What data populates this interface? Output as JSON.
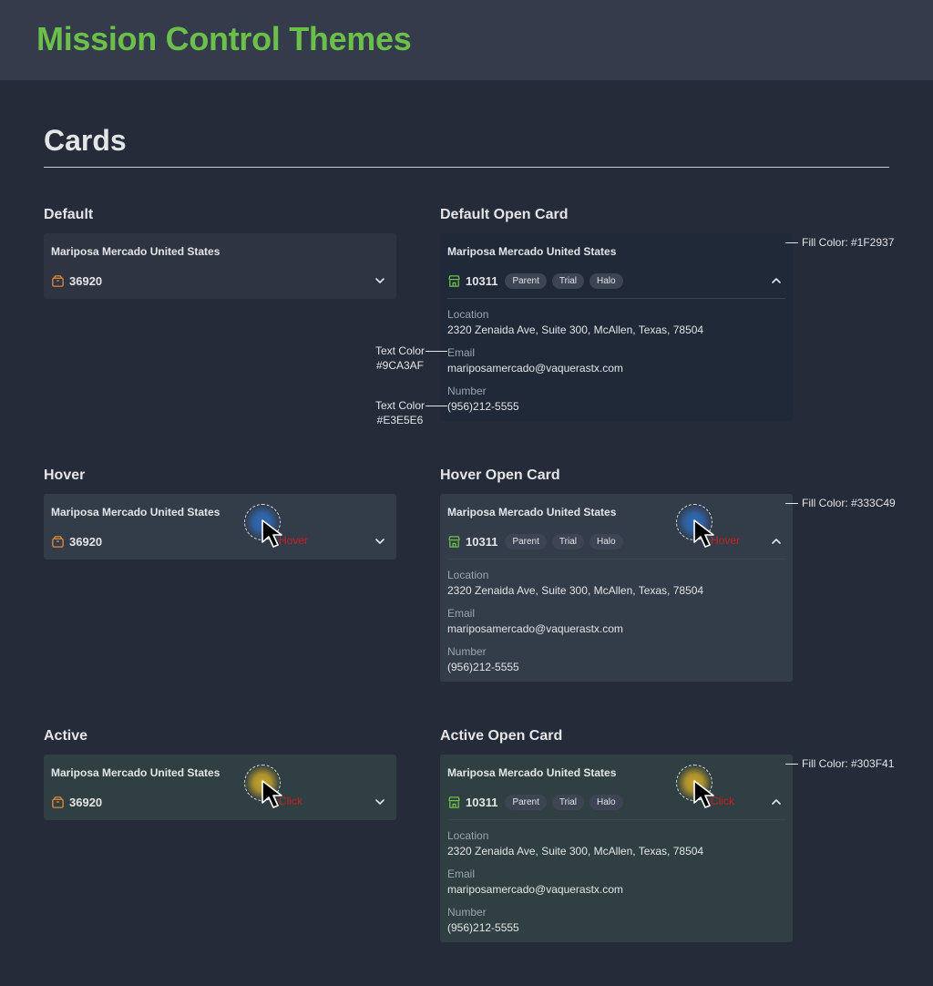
{
  "app": {
    "title": "Mission Control Themes"
  },
  "section": {
    "title": "Cards"
  },
  "labels": {
    "default": "Default",
    "default_open": "Default Open Card",
    "hover": "Hover",
    "hover_open": "Hover Open Card",
    "active": "Active",
    "active_open": "Active Open Card"
  },
  "closed_card": {
    "name": "Mariposa Mercado United States",
    "id": "36920",
    "icon": "box-icon",
    "icon_color": "#E08A3C",
    "chevron": "chevron-down-icon"
  },
  "open_card": {
    "name": "Mariposa Mercado United States",
    "id": "10311",
    "icon": "storefront-icon",
    "icon_color": "#6CBF4B",
    "chevron": "chevron-up-icon",
    "tags": [
      "Parent",
      "Trial",
      "Halo"
    ],
    "location_label": "Location",
    "location": "2320 Zenaida Ave, Suite 300, McAllen, Texas, 78504",
    "email_label": "Email",
    "email": "mariposamercado@vaquerastx.com",
    "number_label": "Number",
    "number": "(956)212-5555"
  },
  "states": {
    "default": {
      "fill": "#2E3442",
      "open_fill": "#1F2937"
    },
    "hover": {
      "fill": "#333C49",
      "cursor_label": "Hover",
      "cursor_glow": "#2F6AB8"
    },
    "active": {
      "fill": "#303F41",
      "cursor_label": "Click",
      "cursor_glow": "#C9A52A"
    }
  },
  "annotations": {
    "fill_default": "Fill Color: #1F2937",
    "fill_hover": "Fill Color: #333C49",
    "fill_active": "Fill Color: #303F41",
    "text_secondary_title": "Text Color",
    "text_secondary_value": "#9CA3AF",
    "text_primary_title": "Text Color",
    "text_primary_value": "#E3E5E6"
  }
}
